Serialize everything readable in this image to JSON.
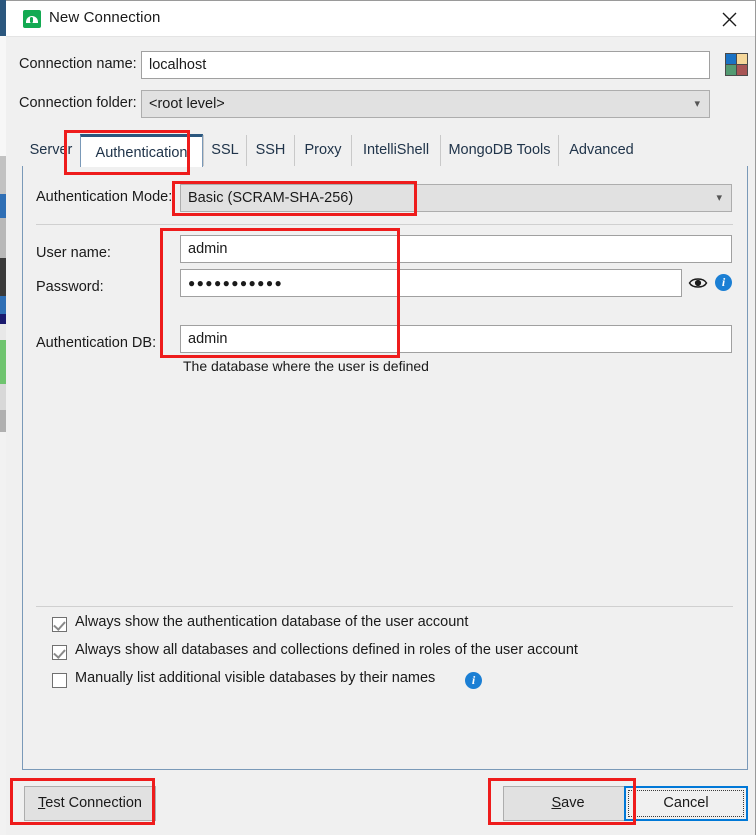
{
  "window": {
    "title": "New Connection",
    "app_icon": "mongodb-leaf-icon",
    "close_icon": "close-icon"
  },
  "header": {
    "connection_name_label": "Connection name:",
    "connection_name_value": "localhost",
    "connection_folder_label": "Connection folder:",
    "connection_folder_value": "<root level>",
    "color_swatch_icon": "color-swatch-icon",
    "swatch_colors": [
      "#1a72c4",
      "#f5d79a",
      "#539a72",
      "#a85555"
    ]
  },
  "tabs": [
    {
      "label": "Server",
      "active": false
    },
    {
      "label": "Authentication",
      "active": true
    },
    {
      "label": "SSL",
      "active": false
    },
    {
      "label": "SSH",
      "active": false
    },
    {
      "label": "Proxy",
      "active": false
    },
    {
      "label": "IntelliShell",
      "active": false
    },
    {
      "label": "MongoDB Tools",
      "active": false
    },
    {
      "label": "Advanced",
      "active": false
    }
  ],
  "authentication": {
    "mode_label": "Authentication Mode:",
    "mode_value": "Basic (SCRAM-SHA-256)",
    "username_label": "User name:",
    "username_value": "admin",
    "password_label": "Password:",
    "password_value": "●●●●●●●●●●●",
    "password_reveal_icon": "eye-icon",
    "password_info_icon": "info-icon",
    "authdb_label": "Authentication DB:",
    "authdb_value": "admin",
    "authdb_help": "The database where the user is defined",
    "checkboxes": [
      {
        "label": "Always show the authentication database of the user account",
        "checked": true,
        "info": false
      },
      {
        "label": "Always show all databases and collections defined in roles of the user account",
        "checked": true,
        "info": false
      },
      {
        "label": "Manually list additional visible databases by their names",
        "checked": false,
        "info": true
      }
    ]
  },
  "footer": {
    "test_connection_label": "Test Connection",
    "test_connection_mnemonic": "T",
    "test_connection_rest": "est Connection",
    "save_label": "Save",
    "save_mnemonic": "S",
    "save_rest": "ave",
    "cancel_label": "Cancel"
  },
  "annotations": {
    "highlight_color": "#ee1c1c",
    "boxes": [
      "tab-authentication",
      "authentication-mode-value",
      "credential-fields-group",
      "test-connection-button",
      "save-button"
    ]
  }
}
